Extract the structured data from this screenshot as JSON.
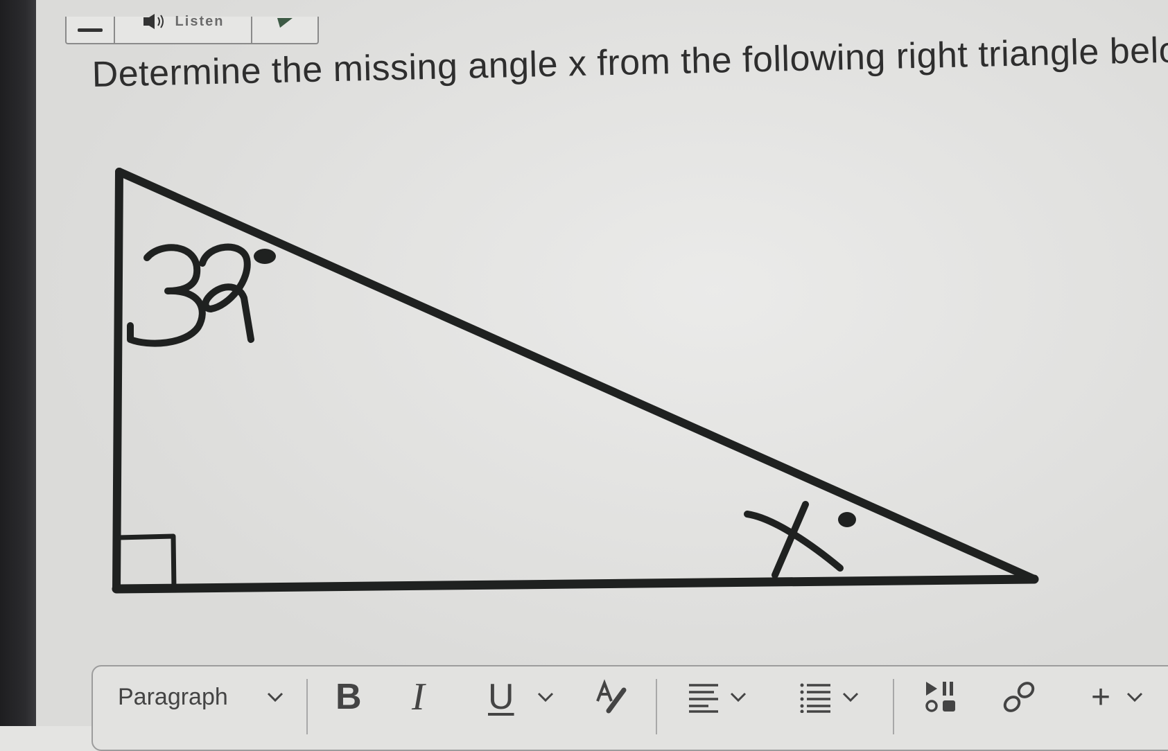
{
  "toolbar": {
    "menu_icon": "hamburger-icon",
    "listen_icon": "speaker-icon",
    "listen_label": "Listen",
    "flag_icon": "flag-icon"
  },
  "question": {
    "text": "Determine the missing angle x from the following right triangle below."
  },
  "figure": {
    "top_angle_label": "32",
    "bottom_angle_label": "x",
    "degree_symbol": "°",
    "right_angle_marker": "square"
  },
  "editor": {
    "block_format": "Paragraph",
    "bold_label": "B",
    "italic_label": "I",
    "underline_label": "U",
    "insert_label": "+",
    "icons": [
      "chevron-down-icon",
      "text-color-icon",
      "align-icon",
      "list-icon",
      "media-icon",
      "link-icon"
    ]
  },
  "colors": {
    "ink": "#1f2120",
    "background": "#e4e4e2",
    "text": "#2e2e2e"
  }
}
